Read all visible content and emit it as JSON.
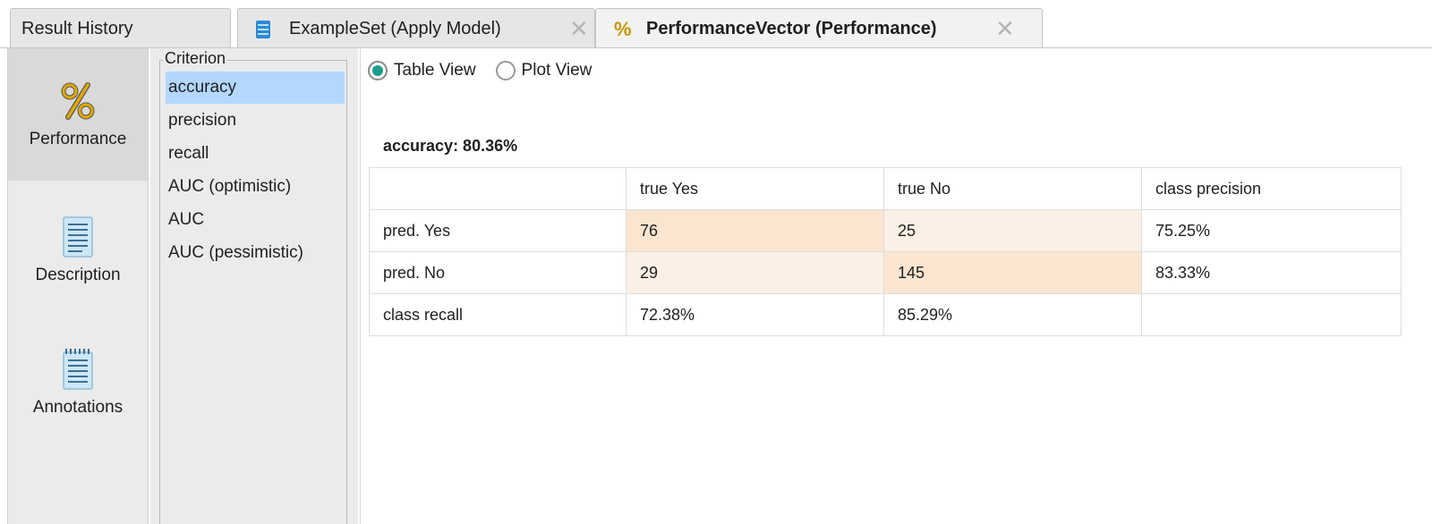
{
  "tabs": {
    "history": "Result History",
    "example": "ExampleSet (Apply Model)",
    "performance": "PerformanceVector (Performance)",
    "close_glyph": "✕",
    "performance_icon_glyph": "%",
    "example_icon": "database-icon"
  },
  "nav": {
    "performance": "Performance",
    "description": "Description",
    "annotations": "Annotations",
    "selected": "Performance"
  },
  "criterion": {
    "legend": "Criterion",
    "items": [
      "accuracy",
      "precision",
      "recall",
      "AUC (optimistic)",
      "AUC",
      "AUC (pessimistic)"
    ],
    "selected": "accuracy"
  },
  "view": {
    "table_view": "Table View",
    "plot_view": "Plot View",
    "selected": "Table View"
  },
  "metric": {
    "title": "accuracy: 80.36%"
  },
  "confusion_matrix": {
    "header": [
      "",
      "true Yes",
      "true No",
      "class precision"
    ],
    "rows": [
      [
        "pred. Yes",
        "76",
        "25",
        "75.25%"
      ],
      [
        "pred. No",
        "29",
        "145",
        "83.33%"
      ],
      [
        "class recall",
        "72.38%",
        "85.29%",
        ""
      ]
    ]
  },
  "colors": {
    "selection": "#b3d7ff",
    "radio_accent": "#1b9e8a",
    "cell_strong": "#fae6d0",
    "cell_light": "#fbf0e5",
    "percent_icon": "#e0a800"
  }
}
